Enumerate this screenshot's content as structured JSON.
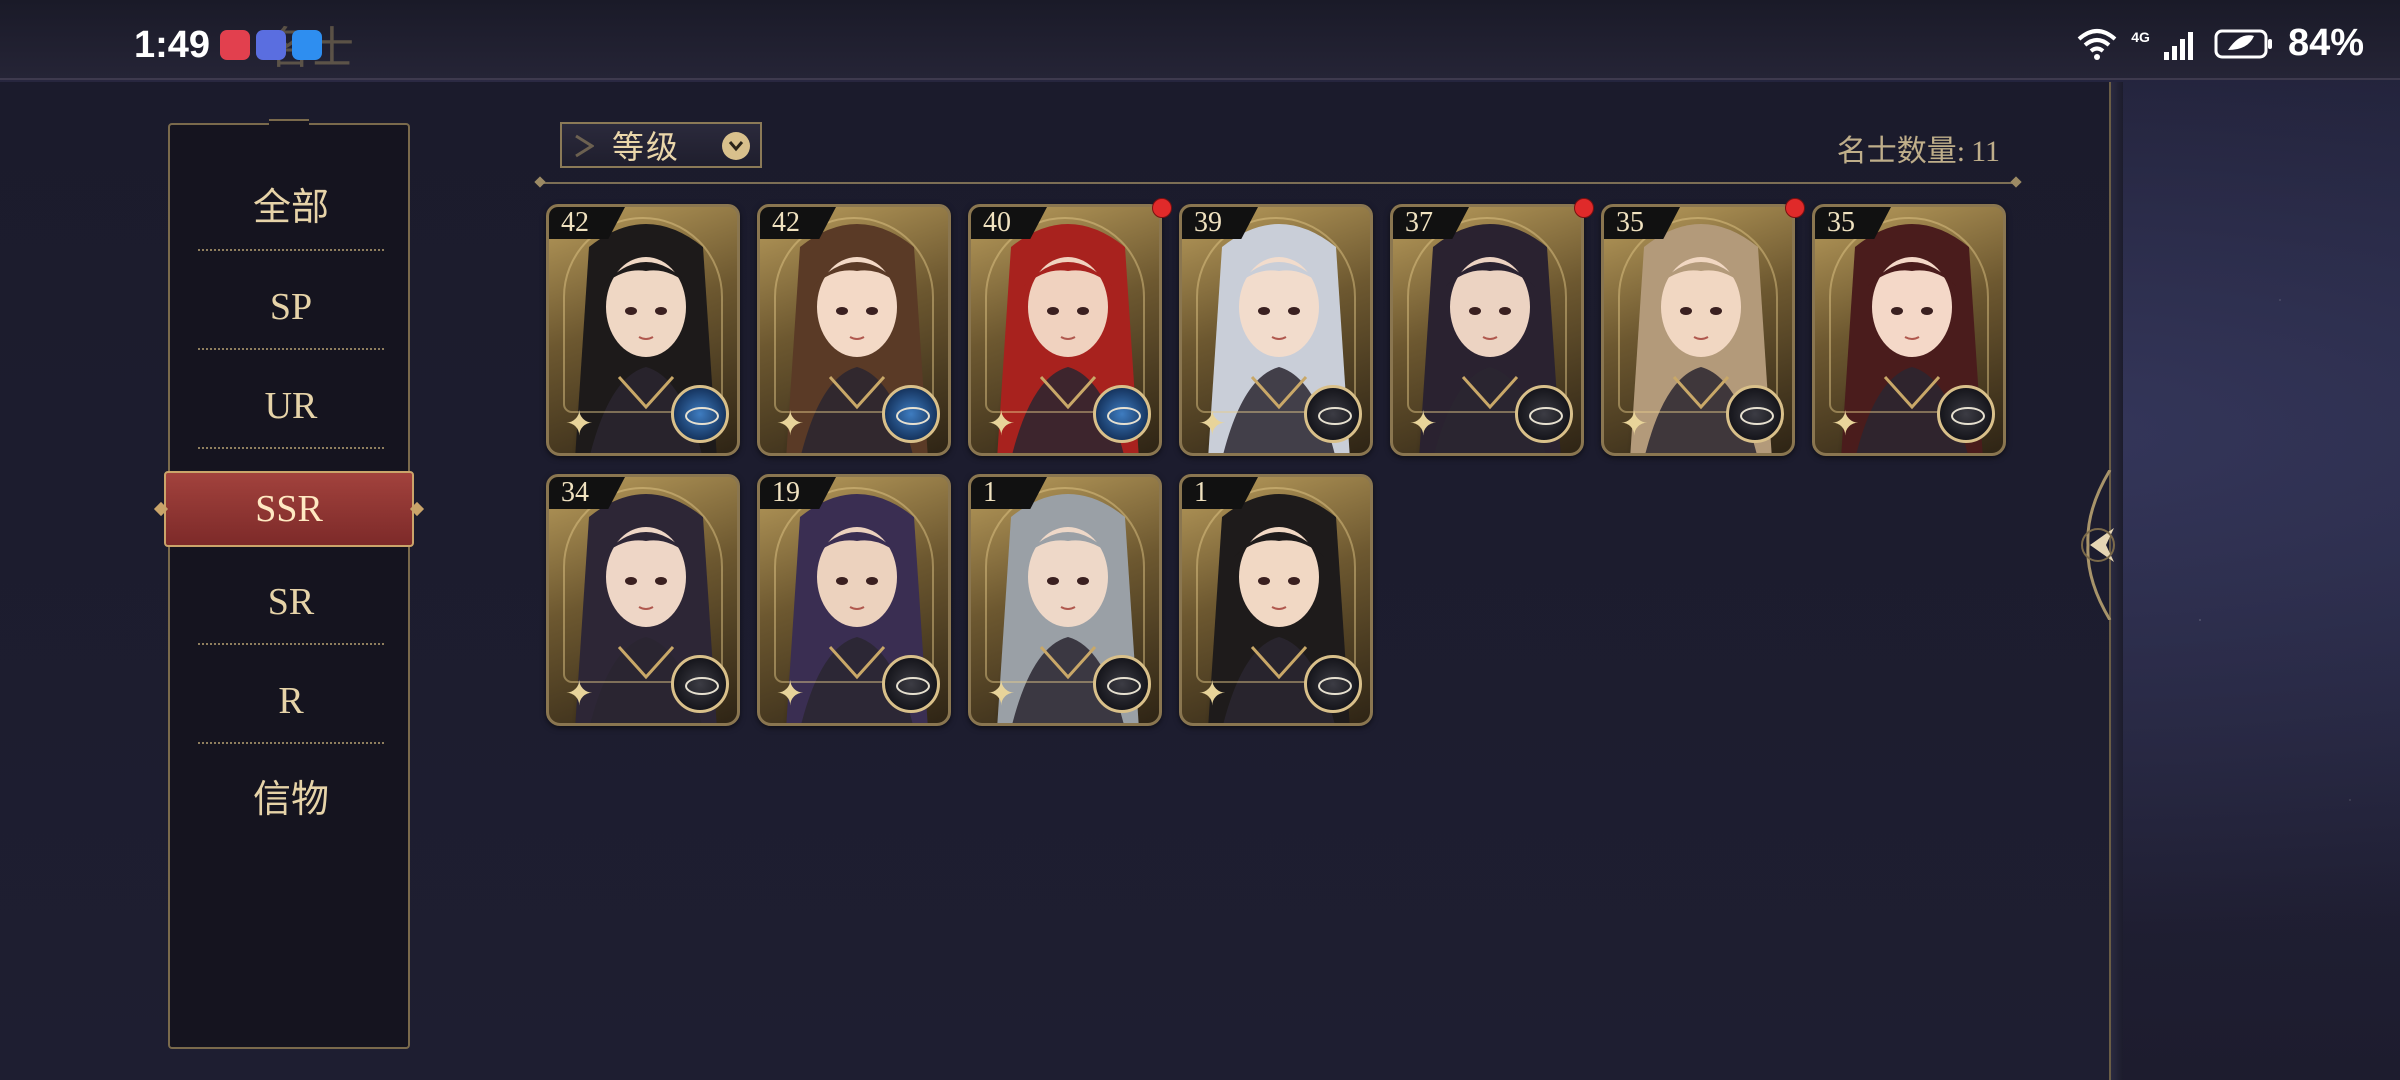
{
  "statusbar": {
    "time": "1:49",
    "network": "4G",
    "battery": "84%",
    "screen_title": "名士"
  },
  "sidebar": {
    "items": [
      {
        "label": "全部",
        "active": false
      },
      {
        "label": "SP",
        "active": false
      },
      {
        "label": "UR",
        "active": false
      },
      {
        "label": "SSR",
        "active": true
      },
      {
        "label": "SR",
        "active": false
      },
      {
        "label": "R",
        "active": false
      },
      {
        "label": "信物",
        "active": false
      }
    ]
  },
  "toolbar": {
    "sort_label": "等级",
    "count_label": "名士数量:",
    "count_value": "11"
  },
  "cards": [
    {
      "level": "42",
      "hair": "#1d1a1a",
      "skin": "#efd7c4",
      "emblem": "blue",
      "badge": false
    },
    {
      "level": "42",
      "hair": "#5a3a26",
      "skin": "#f3d9c6",
      "emblem": "blue",
      "badge": false
    },
    {
      "level": "40",
      "hair": "#a8221e",
      "skin": "#f0d2bf",
      "emblem": "blue",
      "badge": true
    },
    {
      "level": "39",
      "hair": "#c9ced8",
      "skin": "#f2dccc",
      "emblem": "dark",
      "badge": false
    },
    {
      "level": "37",
      "hair": "#2a2230",
      "skin": "#ecd3c2",
      "emblem": "dark",
      "badge": true
    },
    {
      "level": "35",
      "hair": "#b39a7a",
      "skin": "#f1d7c2",
      "emblem": "dark",
      "badge": true
    },
    {
      "level": "35",
      "hair": "#4a1c1c",
      "skin": "#f4d8c8",
      "emblem": "dark",
      "badge": false
    },
    {
      "level": "34",
      "hair": "#2d2636",
      "skin": "#eed6c6",
      "emblem": "dark",
      "badge": false
    },
    {
      "level": "19",
      "hair": "#3a2e52",
      "skin": "#ecd2be",
      "emblem": "dark",
      "badge": false
    },
    {
      "level": "1",
      "hair": "#9aa0a6",
      "skin": "#eed8c8",
      "emblem": "dark",
      "badge": false
    },
    {
      "level": "1",
      "hair": "#1e1b1b",
      "skin": "#f1d8c4",
      "emblem": "dark",
      "badge": false
    }
  ],
  "colors": {
    "accent_gold": "#caa46a",
    "active_tab": "#9a3a36",
    "badge_red": "#e02a2a"
  }
}
